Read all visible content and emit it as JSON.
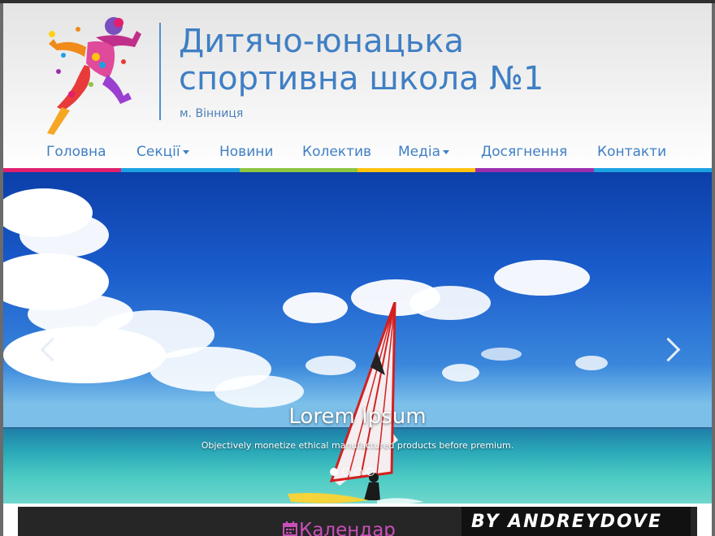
{
  "header": {
    "title_line1": "Дитячо-юнацька",
    "title_line2": "спортивна школа №1",
    "city": "м. Вінниця"
  },
  "nav": {
    "items": [
      {
        "label": "Головна"
      },
      {
        "label": "Секції"
      },
      {
        "label": "Новини"
      },
      {
        "label": "Колектив"
      },
      {
        "label": "Медіа"
      },
      {
        "label": "Досягнення"
      },
      {
        "label": "Контакти"
      }
    ]
  },
  "colors": {
    "title": "#3f7fc4",
    "colorbar": [
      "#e0206f",
      "#1ba1e2",
      "#8dc63f",
      "#ffc20e",
      "#9b2fae",
      "#1ba1e2"
    ],
    "calendar_accent": "#c94fb8"
  },
  "slider": {
    "caption_title": "Lorem Ipsum",
    "caption_text": "Objectively monetize ethical manufactured products before premium.",
    "slide_count": 4,
    "active_slide": 1
  },
  "calendar": {
    "label": "Календар",
    "icon": "calendar-icon"
  },
  "watermark": {
    "text": "BY ANDREYDOVE"
  }
}
